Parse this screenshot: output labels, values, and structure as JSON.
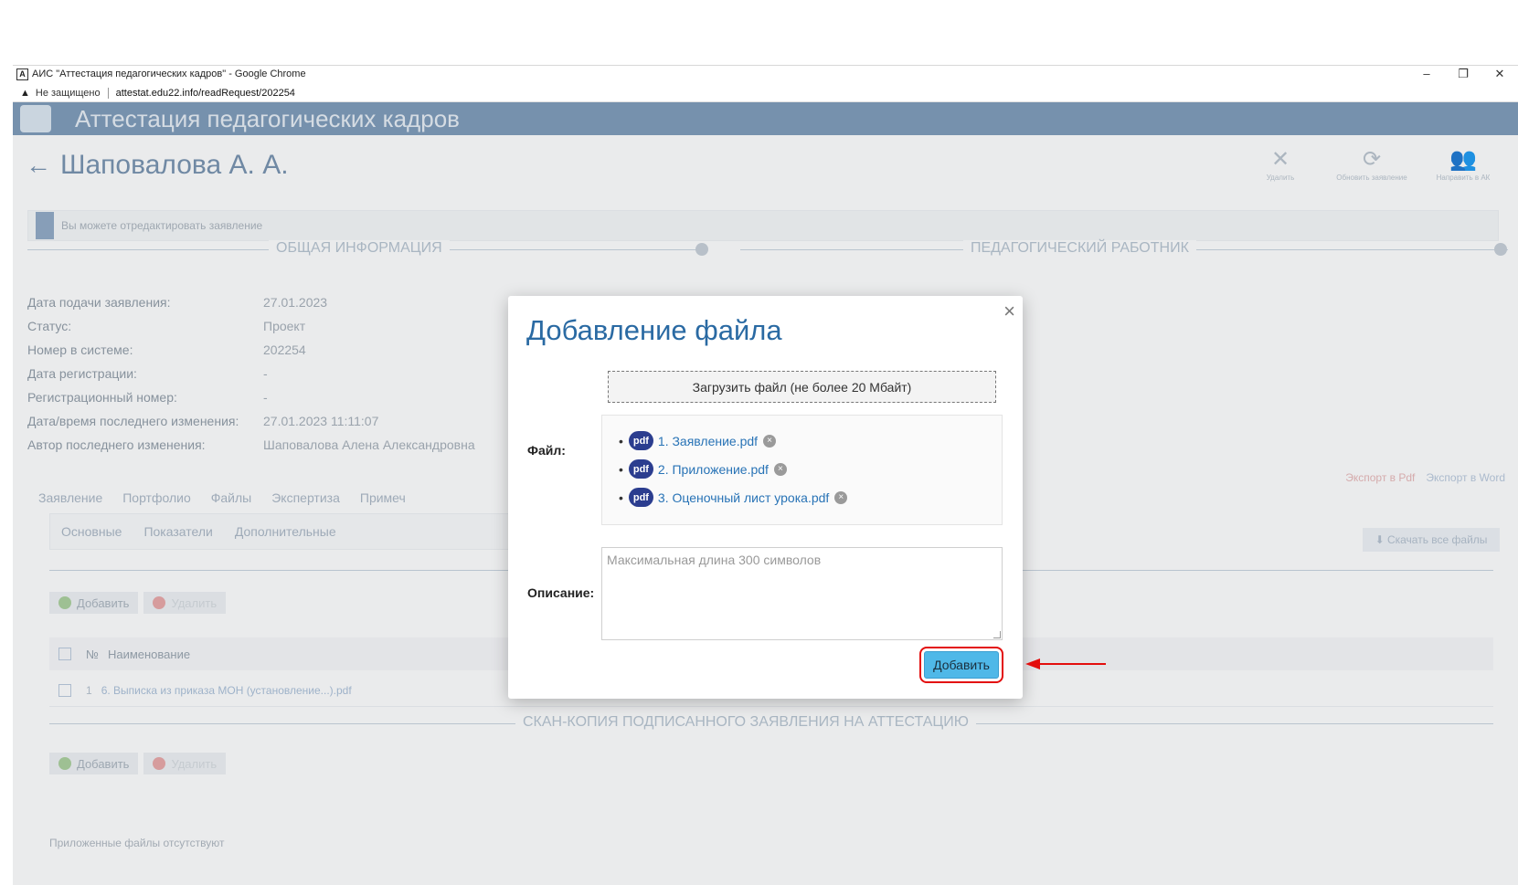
{
  "browser": {
    "window_title": "АИС \"Аттестация педагогических кадров\" - Google Chrome",
    "security_label": "Не защищено",
    "url": "attestat.edu22.info/readRequest/202254",
    "window_controls": [
      "–",
      "❐",
      "✕"
    ]
  },
  "app": {
    "title": "Аттестация педагогических кадров",
    "person_name": "Шаповалова А. А.",
    "top_actions": [
      {
        "label": "Удалить",
        "icon": "close-icon"
      },
      {
        "label": "Обновить заявление",
        "icon": "refresh-icon"
      },
      {
        "label": "Направить в АК",
        "icon": "users-icon"
      }
    ],
    "notice": "Вы можете отредактировать заявление",
    "sections": {
      "general": "ОБЩАЯ ИНФОРМАЦИЯ",
      "worker": "ПЕДАГОГИЧЕСКИЙ РАБОТНИК",
      "scan": "СКАН-КОПИЯ ПОДПИСАННОГО ЗАЯВЛЕНИЯ НА АТТЕСТАЦИЮ"
    },
    "info": [
      {
        "label": "Дата подачи заявления:",
        "value": "27.01.2023"
      },
      {
        "label": "Статус:",
        "value": "Проект"
      },
      {
        "label": "Номер в системе:",
        "value": "202254"
      },
      {
        "label": "Дата регистрации:",
        "value": "-"
      },
      {
        "label": "Регистрационный номер:",
        "value": "-"
      },
      {
        "label": "Дата/время последнего изменения:",
        "value": "27.01.2023 11:11:07"
      },
      {
        "label": "Автор последнего изменения:",
        "value": "Шаповалова Алена Александровна"
      }
    ],
    "tabs": [
      "Заявление",
      "Портфолио",
      "Файлы",
      "Экспертиза",
      "Примеч"
    ],
    "subtabs": [
      "Основные",
      "Показатели",
      "Дополнительные"
    ],
    "export_pdf": "Экспорт в Pdf",
    "export_word": "Экспорт в Word",
    "download_all": "Скачать все файлы",
    "add_label": "Добавить",
    "delete_label": "Удалить",
    "grid": {
      "col_num": "№",
      "col_name": "Наименование",
      "row_num": "1",
      "row_name": "6. Выписка из приказа МОН (установление...).pdf",
      "row_extra": "-"
    },
    "no_files": "Приложенные файлы отсутствуют"
  },
  "modal": {
    "title": "Добавление файла",
    "close": "×",
    "upload_label": "Загрузить файл (не более 20 Мбайт)",
    "file_label": "Файл:",
    "badge": "pdf",
    "files": [
      "1. Заявление.pdf",
      "2. Приложение.pdf",
      "3. Оценочный лист урока.pdf"
    ],
    "description_label": "Описание:",
    "description_placeholder": "Максимальная длина 300 символов",
    "description_value": "",
    "submit_label": "Добавить"
  },
  "colors": {
    "accent": "#2a6aa3",
    "submit_button": "#4fb8e8",
    "highlight_frame": "#e30d0d",
    "pdf_badge": "#2b3d8f"
  }
}
